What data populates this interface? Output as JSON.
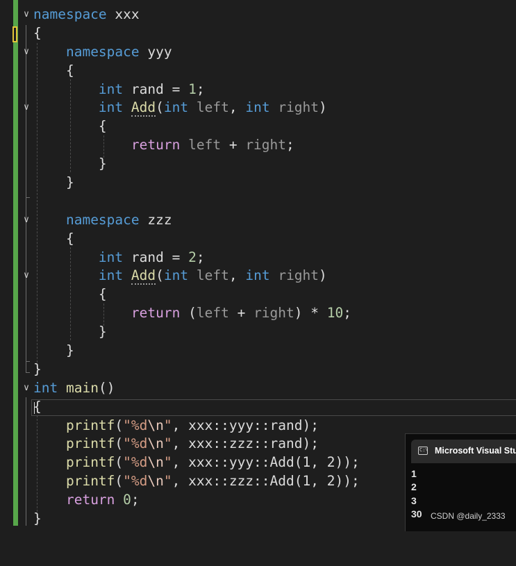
{
  "code": {
    "l1_kw": "namespace",
    "l1_name": "xxx",
    "l2": "{",
    "l3_kw": "namespace",
    "l3_name": "yyy",
    "l4": "{",
    "l5_type": "int",
    "l5_var": "rand",
    "l5_eq": "=",
    "l5_num": "1",
    "l5_end": ";",
    "l6_type": "int",
    "l6_fn": "Add",
    "l6_p1": "(",
    "l6_t1": "int",
    "l6_a1": "left",
    "l6_comma": ",",
    "l6_t2": "int",
    "l6_a2": "right",
    "l6_p2": ")",
    "l7": "{",
    "l8_kw": "return",
    "l8_a": "left",
    "l8_op": "+",
    "l8_b": "right",
    "l8_end": ";",
    "l9": "}",
    "l10": "}",
    "l12_kw": "namespace",
    "l12_name": "zzz",
    "l13": "{",
    "l14_type": "int",
    "l14_var": "rand",
    "l14_eq": "=",
    "l14_num": "2",
    "l14_end": ";",
    "l15_type": "int",
    "l15_fn": "Add",
    "l15_p1": "(",
    "l15_t1": "int",
    "l15_a1": "left",
    "l15_comma": ",",
    "l15_t2": "int",
    "l15_a2": "right",
    "l15_p2": ")",
    "l16": "{",
    "l17_kw": "return",
    "l17_p1": "(",
    "l17_a": "left",
    "l17_op": "+",
    "l17_b": "right",
    "l17_p2": ")",
    "l17_mul": "*",
    "l17_num": "10",
    "l17_end": ";",
    "l18": "}",
    "l19": "}",
    "l20": "}",
    "l21_type": "int",
    "l21_fn": "main",
    "l21_parens": "()",
    "l22": "{",
    "pf": "printf",
    "lp": "(",
    "fmt_open": "\"%d",
    "fmt_esc": "\\n",
    "fmt_close": "\"",
    "comma": ",",
    "l23_rest": "xxx::yyy::rand",
    "l24_rest": "xxx::zzz::rand",
    "l25_rest": "xxx::yyy::Add(1, 2)",
    "l26_rest": "xxx::zzz::Add(1, 2)",
    "rp_end": ");",
    "l27_kw": "return",
    "l27_num": "0",
    "l27_end": ";",
    "l28": "}"
  },
  "console": {
    "title": "Microsoft Visual Studio",
    "icon_text": "C:\\",
    "output": [
      "1",
      "2",
      "3",
      "30"
    ]
  },
  "watermark": "CSDN @daily_2333",
  "icons": {
    "fold": "chevron-down-icon",
    "console": "console-app-icon"
  },
  "colors": {
    "background": "#1e1e1e",
    "keyword": "#569cd6",
    "control_keyword": "#d8a0df",
    "function": "#dcdcaa",
    "number": "#b5cea8",
    "string": "#d69d85",
    "parameter": "#9a9a9a",
    "change_bar": "#57a64a"
  }
}
